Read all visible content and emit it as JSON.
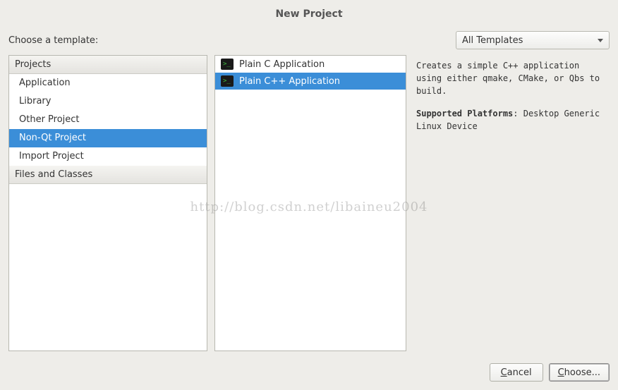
{
  "title": "New Project",
  "choose_label": "Choose a template:",
  "filter_dropdown": {
    "selected": "All Templates"
  },
  "categories": {
    "header1": "Projects",
    "items": [
      {
        "label": "Application",
        "selected": false
      },
      {
        "label": "Library",
        "selected": false
      },
      {
        "label": "Other Project",
        "selected": false
      },
      {
        "label": "Non-Qt Project",
        "selected": true
      },
      {
        "label": "Import Project",
        "selected": false
      }
    ],
    "header2": "Files and Classes"
  },
  "templates": [
    {
      "label": "Plain C Application",
      "selected": false
    },
    {
      "label": "Plain C++ Application",
      "selected": true
    }
  ],
  "description": {
    "text": "Creates a simple C++ application using either qmake, CMake, or Qbs to build.",
    "platforms_label": "Supported Platforms",
    "platforms_value": ": Desktop Generic Linux Device"
  },
  "buttons": {
    "cancel_prefix": "C",
    "cancel_rest": "ancel",
    "choose_prefix": "C",
    "choose_rest": "hoose..."
  },
  "watermark": "http://blog.csdn.net/libaineu2004"
}
